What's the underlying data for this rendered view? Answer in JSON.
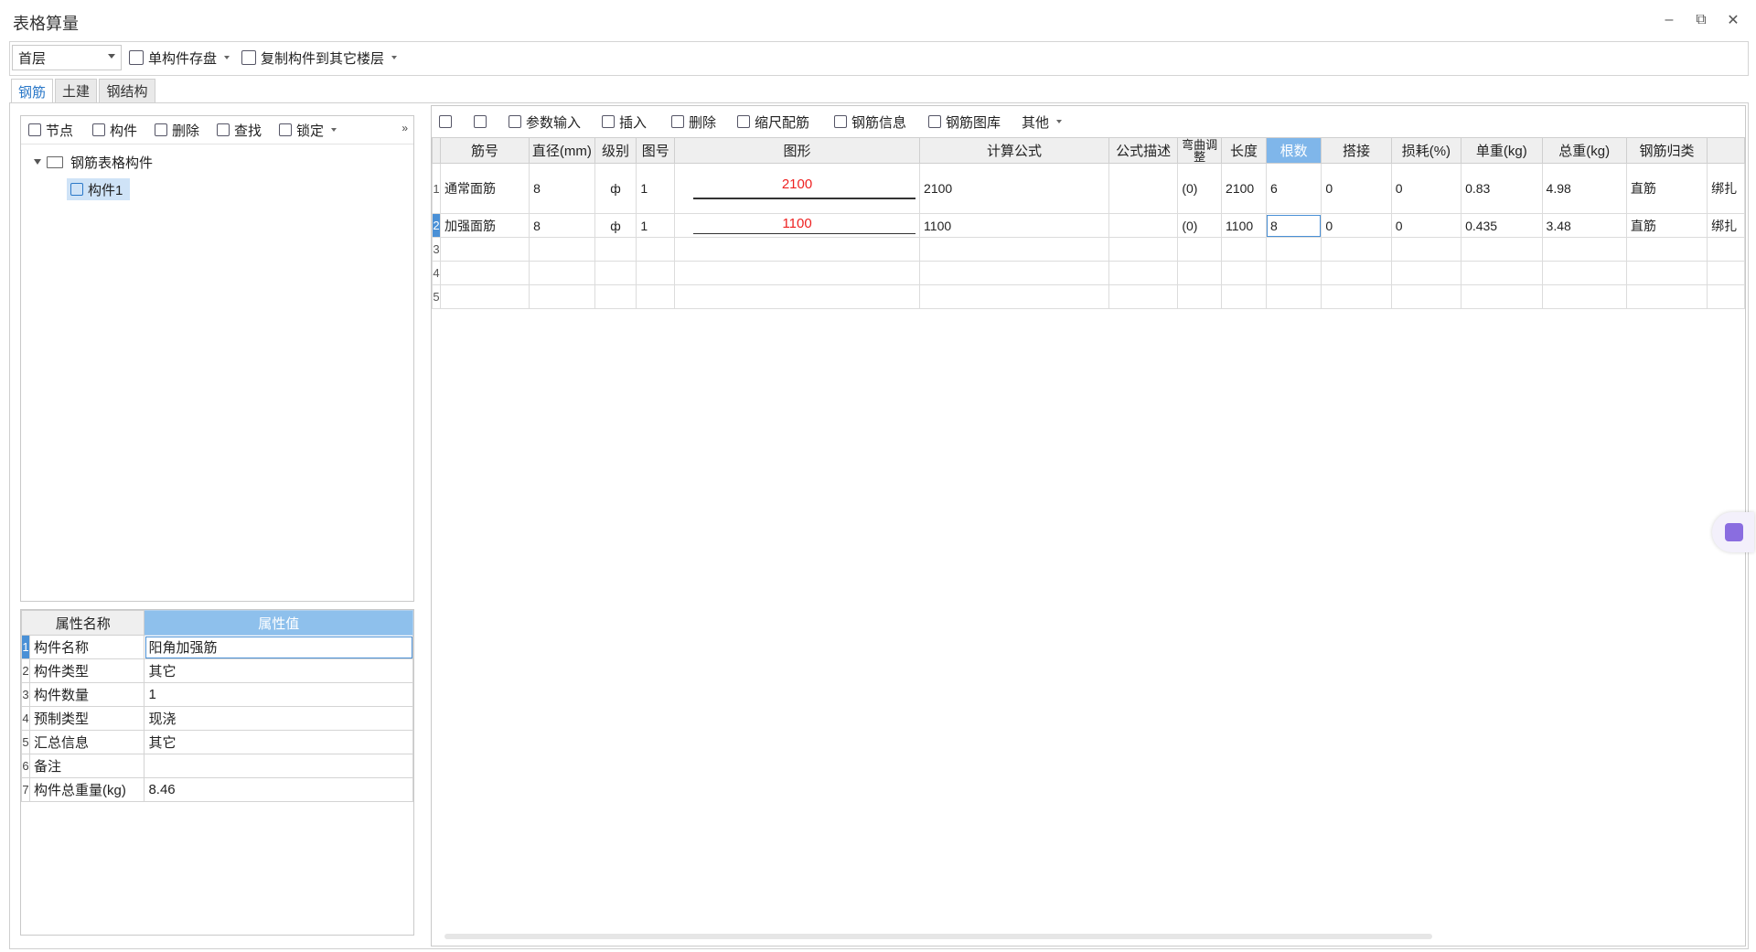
{
  "window": {
    "title": "表格算量",
    "minimize": "–",
    "restore": "⧉",
    "close": "✕"
  },
  "toolbar": {
    "floor": "首层",
    "save_component": "单构件存盘",
    "copy_to_floors": "复制构件到其它楼层"
  },
  "tabs": [
    "钢筋",
    "土建",
    "钢结构"
  ],
  "left_toolbar": {
    "node": "节点",
    "component": "构件",
    "delete": "删除",
    "find": "查找",
    "lock": "锁定",
    "collapse": "»"
  },
  "tree": {
    "root": "钢筋表格构件",
    "children": [
      "构件1"
    ]
  },
  "properties": {
    "headers": [
      "属性名称",
      "属性值"
    ],
    "rows": [
      {
        "no": "1",
        "name": "构件名称",
        "value": "阳角加强筋"
      },
      {
        "no": "2",
        "name": "构件类型",
        "value": "其它"
      },
      {
        "no": "3",
        "name": "构件数量",
        "value": "1"
      },
      {
        "no": "4",
        "name": "预制类型",
        "value": "现浇"
      },
      {
        "no": "5",
        "name": "汇总信息",
        "value": "其它"
      },
      {
        "no": "6",
        "name": "备注",
        "value": ""
      },
      {
        "no": "7",
        "name": "构件总重量(kg)",
        "value": "8.46"
      }
    ]
  },
  "right_toolbar": {
    "param_input": "参数输入",
    "insert": "插入",
    "delete": "删除",
    "scale_rebar": "缩尺配筋",
    "rebar_info": "钢筋信息",
    "rebar_library": "钢筋图库",
    "other": "其他"
  },
  "grid": {
    "headers": [
      "筋号",
      "直径(mm)",
      "级别",
      "图号",
      "图形",
      "计算公式",
      "公式描述",
      "弯曲调整",
      "长度",
      "根数",
      "搭接",
      "损耗(%)",
      "单重(kg)",
      "总重(kg)",
      "钢筋归类",
      ""
    ],
    "rows": [
      {
        "no": "1",
        "name": "通常面筋",
        "diameter": "8",
        "grade": "ф",
        "fig": "1",
        "shape_label": "2100",
        "formula": "2100",
        "desc": "",
        "bend": "(0)",
        "length": "2100",
        "count": "6",
        "lap": "0",
        "loss": "0",
        "unit_weight": "0.83",
        "total_weight": "4.98",
        "category": "直筋",
        "extra": "绑扎"
      },
      {
        "no": "2",
        "name": "加强面筋",
        "diameter": "8",
        "grade": "ф",
        "fig": "1",
        "shape_label": "1100",
        "formula": "1100",
        "desc": "",
        "bend": "(0)",
        "length": "1100",
        "count": "8",
        "lap": "0",
        "loss": "0",
        "unit_weight": "0.435",
        "total_weight": "3.48",
        "category": "直筋",
        "extra": "绑扎"
      }
    ],
    "empty_rows": [
      "3",
      "4",
      "5"
    ]
  }
}
